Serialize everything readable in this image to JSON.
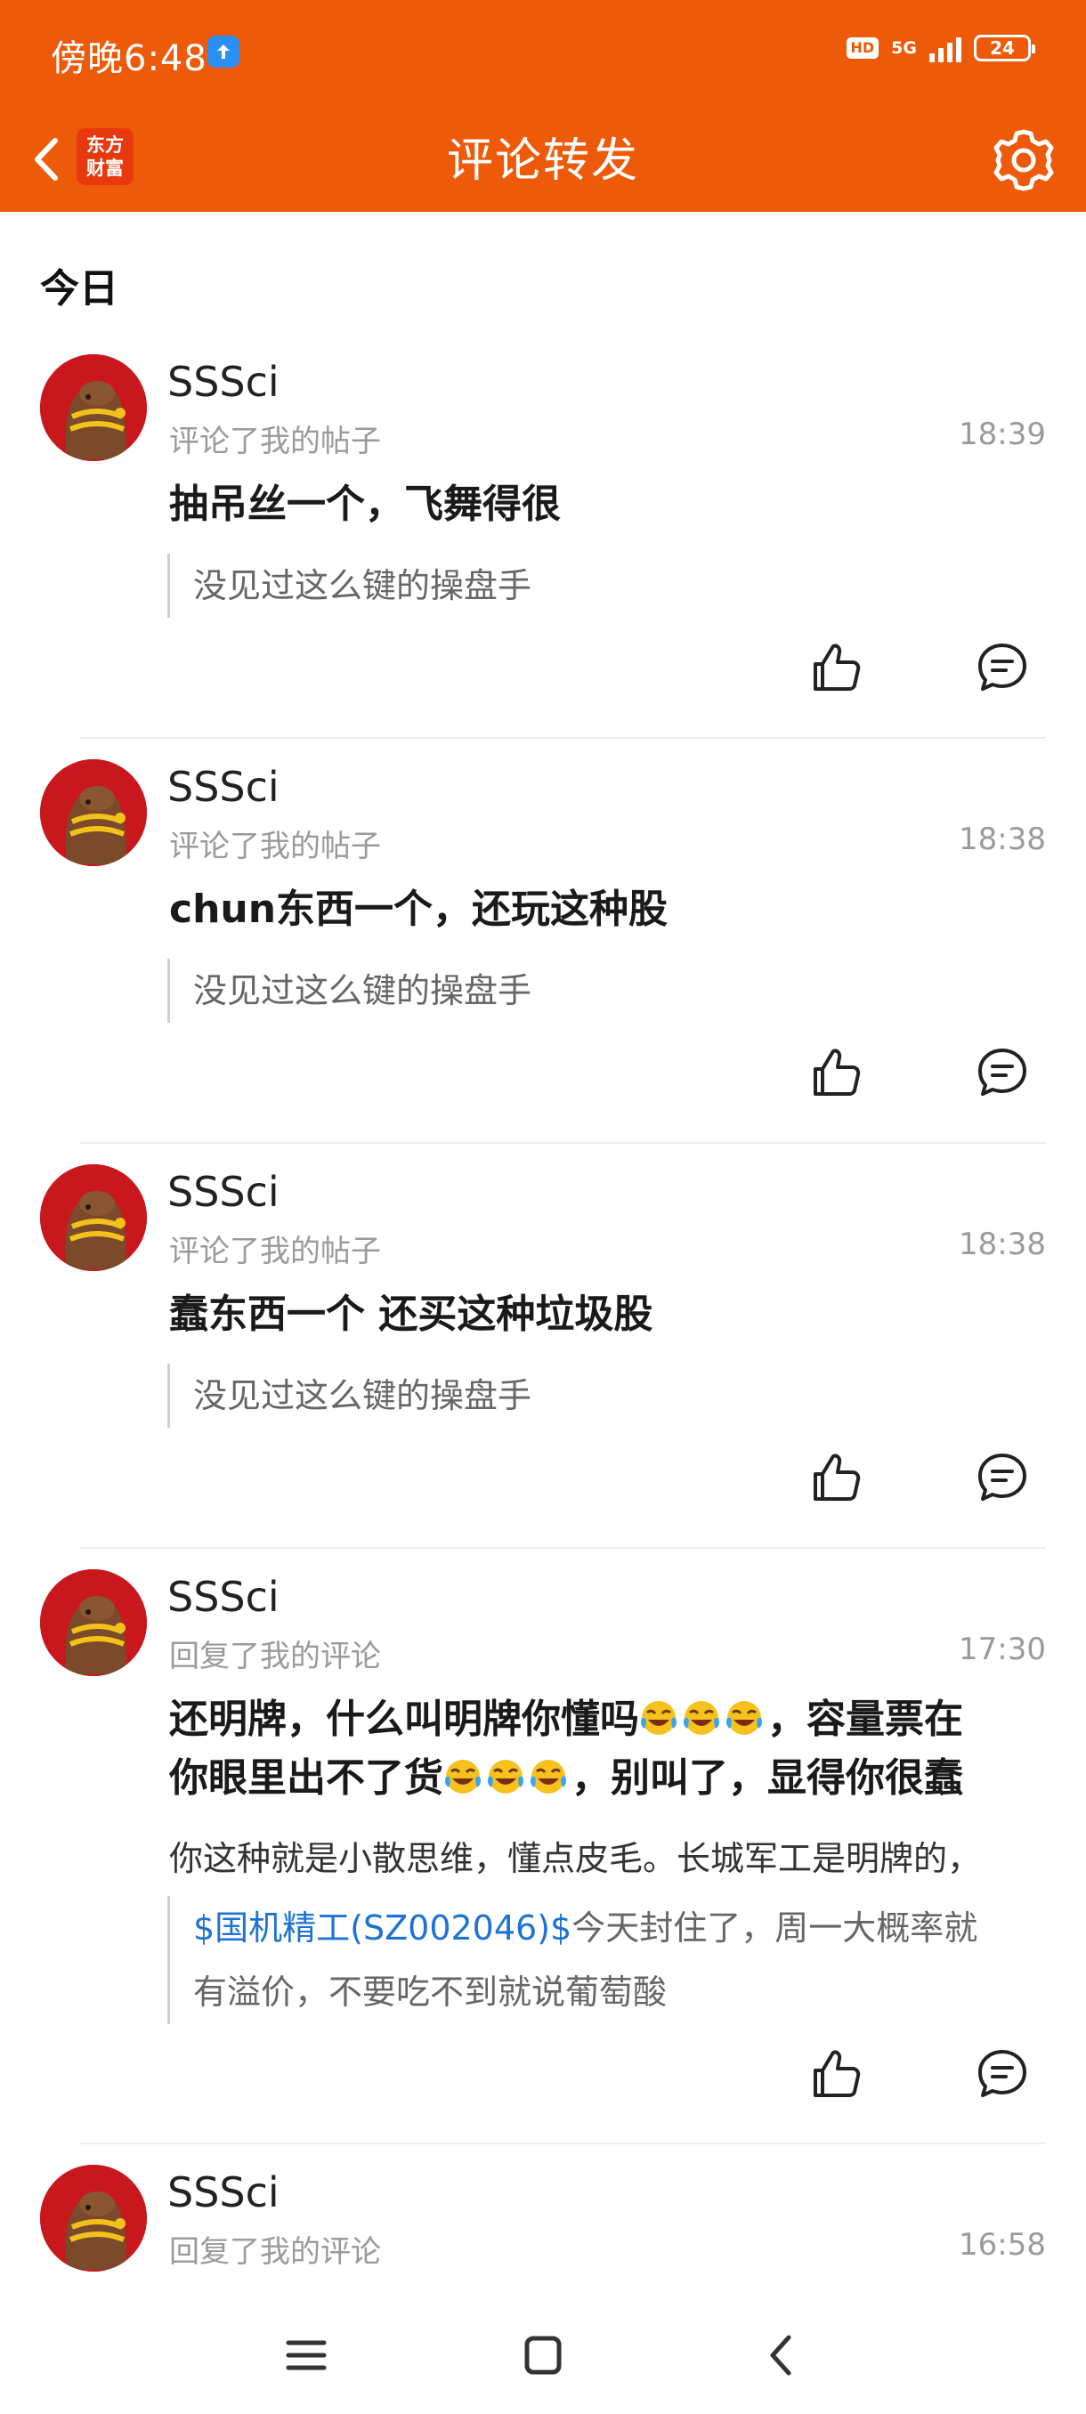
{
  "status_bar": {
    "time": "傍晚6:48",
    "hd": "HD",
    "network": "5G",
    "battery": "24"
  },
  "header": {
    "title": "评论转发",
    "logo_text_line1": "东方",
    "logo_text_line2": "财富"
  },
  "section": {
    "today": "今日"
  },
  "notifications": [
    {
      "user": "SSSci",
      "action": "评论了我的帖子",
      "time": "18:39",
      "comment": "抽吊丝一个，飞舞得很",
      "quote": "没见过这么键的操盘手"
    },
    {
      "user": "SSSci",
      "action": "评论了我的帖子",
      "time": "18:38",
      "comment": "chun东西一个，还玩这种股",
      "quote": "没见过这么键的操盘手"
    },
    {
      "user": "SSSci",
      "action": "评论了我的帖子",
      "time": "18:38",
      "comment": "蠢东西一个 还买这种垃圾股",
      "quote": "没见过这么键的操盘手"
    },
    {
      "user": "SSSci",
      "action": "回复了我的评论",
      "time": "17:30",
      "comment_part1": "还明牌，什么叫明牌你懂吗",
      "comment_part2": "，容量票在",
      "comment_part3": "你眼里出不了货",
      "comment_part4": "，别叫了，显得你很蠢",
      "reply_text": "你这种就是小散思维，懂点皮毛。长城军工是明牌的，",
      "quote_link": "$国机精工(SZ002046)$",
      "quote_rest": "今天封住了，周一大概率就",
      "quote_line2": "有溢价，不要吃不到就说葡萄酸"
    },
    {
      "user": "SSSci",
      "action": "回复了我的评论",
      "time": "16:58"
    }
  ],
  "icons": {
    "back": "back-arrow-icon",
    "settings": "gear-icon",
    "like": "thumbs-up-icon",
    "reply": "comment-bubble-icon",
    "emoji": "rolling-laughing-emoji",
    "menu": "menu-icon",
    "home": "home-square-icon",
    "nav_back": "nav-back-icon"
  },
  "colors": {
    "brand": "#ec5a0a",
    "link": "#1e73d2",
    "avatar_bg": "#c8181e"
  }
}
